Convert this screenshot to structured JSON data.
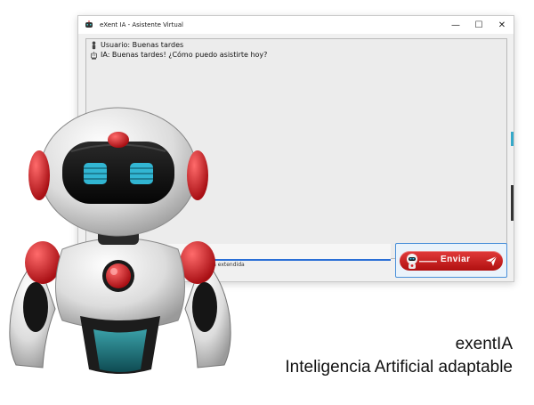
{
  "window": {
    "title": "eXent IA - Asistente Virtual",
    "controls": {
      "minimize": "—",
      "maximize": "☐",
      "close": "✕"
    }
  },
  "chat": {
    "messages": [
      {
        "icon": "user-icon",
        "text": "Usuario: Buenas tardes"
      },
      {
        "icon": "robot-icon",
        "text": "IA: Buenas tardes! ¿Cómo puedo asistirte hoy?"
      }
    ]
  },
  "input": {
    "value": ""
  },
  "option": {
    "label": "esta extendida"
  },
  "send_button": {
    "label": "Enviar"
  },
  "captions": {
    "brand": "exentIA",
    "tagline": "Inteligencia Artificial adaptable"
  },
  "colors": {
    "accent": "#2a6fd6",
    "robot_red": "#d61f26",
    "visor_glow": "#35c8e8"
  }
}
